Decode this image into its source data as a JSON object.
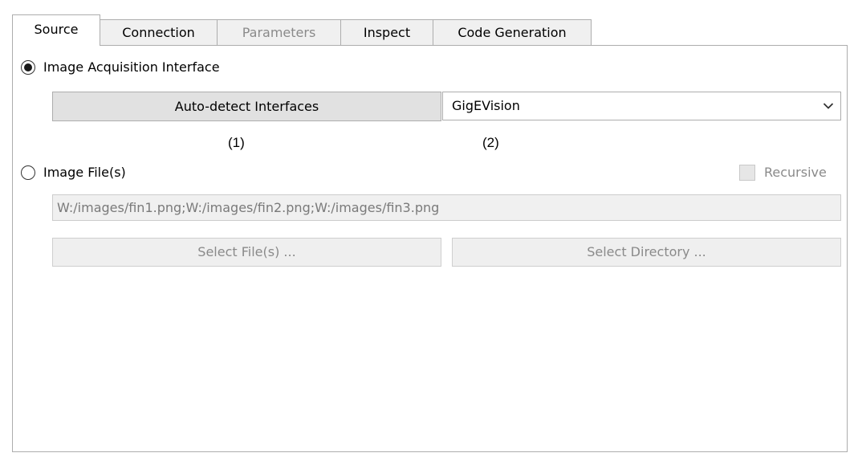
{
  "tabs": [
    {
      "label": "Source",
      "active": true,
      "enabled": true
    },
    {
      "label": "Connection",
      "active": false,
      "enabled": true
    },
    {
      "label": "Parameters",
      "active": false,
      "enabled": false
    },
    {
      "label": "Inspect",
      "active": false,
      "enabled": true
    },
    {
      "label": "Code Generation",
      "active": false,
      "enabled": true
    }
  ],
  "source": {
    "acquisition": {
      "label": "Image Acquisition Interface",
      "selected": true,
      "autodetect_label": "Auto-detect Interfaces",
      "interface_value": "GigEVision"
    },
    "annotations": {
      "one": "(1)",
      "two": "(2)"
    },
    "files": {
      "label": "Image File(s)",
      "selected": false,
      "recursive_label": "Recursive",
      "recursive_checked": false,
      "path_value": "W:/images/fin1.png;W:/images/fin2.png;W:/images/fin3.png",
      "select_files_label": "Select File(s) ...",
      "select_directory_label": "Select Directory ..."
    }
  },
  "icons": {
    "combo_arrow": "chevron-down-icon"
  }
}
